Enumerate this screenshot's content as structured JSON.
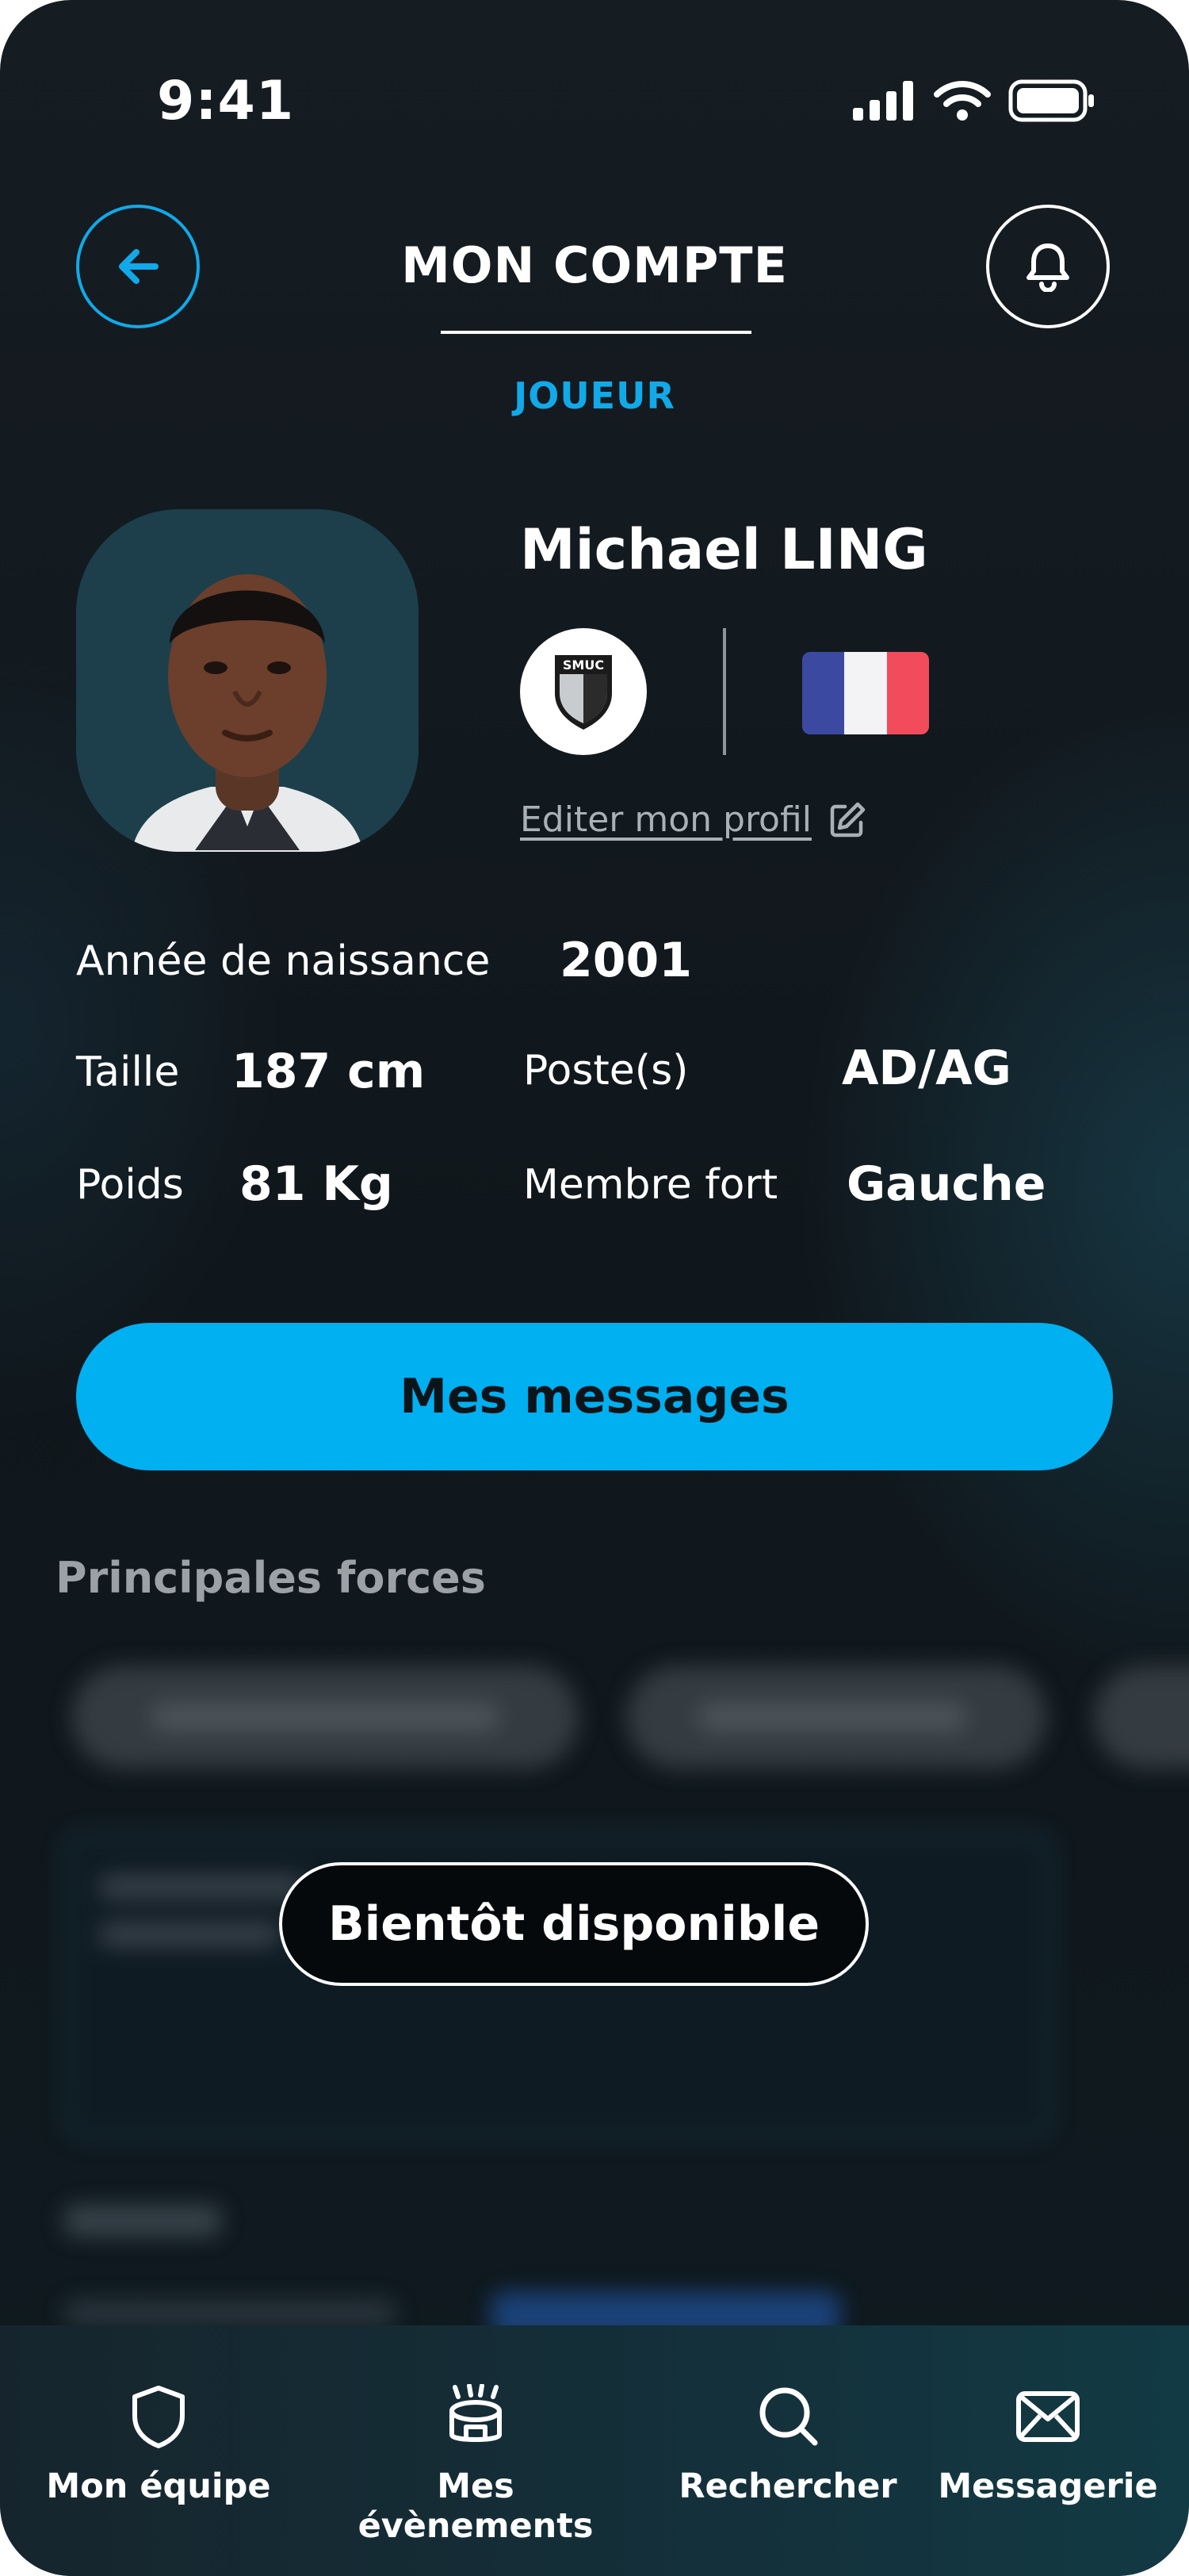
{
  "status_bar": {
    "time": "9:41"
  },
  "header": {
    "title": "MON COMPTE",
    "subtitle": "JOUEUR"
  },
  "profile": {
    "name": "Michael LING",
    "club": "SMUC",
    "edit_label": "Editer mon profil"
  },
  "stats": {
    "birth_year_label": "Année de naissance",
    "birth_year_value": "2001",
    "height_label": "Taille",
    "height_value": "187 cm",
    "position_label": "Poste(s)",
    "position_value": "AD/AG",
    "weight_label": "Poids",
    "weight_value": "81 Kg",
    "foot_label": "Membre fort",
    "foot_value": "Gauche"
  },
  "actions": {
    "messages_label": "Mes messages"
  },
  "strengths": {
    "title": "Principales forces",
    "overlay_label": "Bientôt disponible"
  },
  "nav": [
    {
      "label": "Mon équipe",
      "icon": "shield-icon"
    },
    {
      "label": "Mes évènements",
      "icon": "stadium-icon"
    },
    {
      "label": "Rechercher",
      "icon": "search-icon"
    },
    {
      "label": "Messagerie",
      "icon": "mail-icon"
    }
  ],
  "colors": {
    "accent": "#00b0f0",
    "background": "#11181d",
    "flag_blue": "#3b4aa0",
    "flag_white": "#f3f3f6",
    "flag_red": "#f14b5c"
  }
}
